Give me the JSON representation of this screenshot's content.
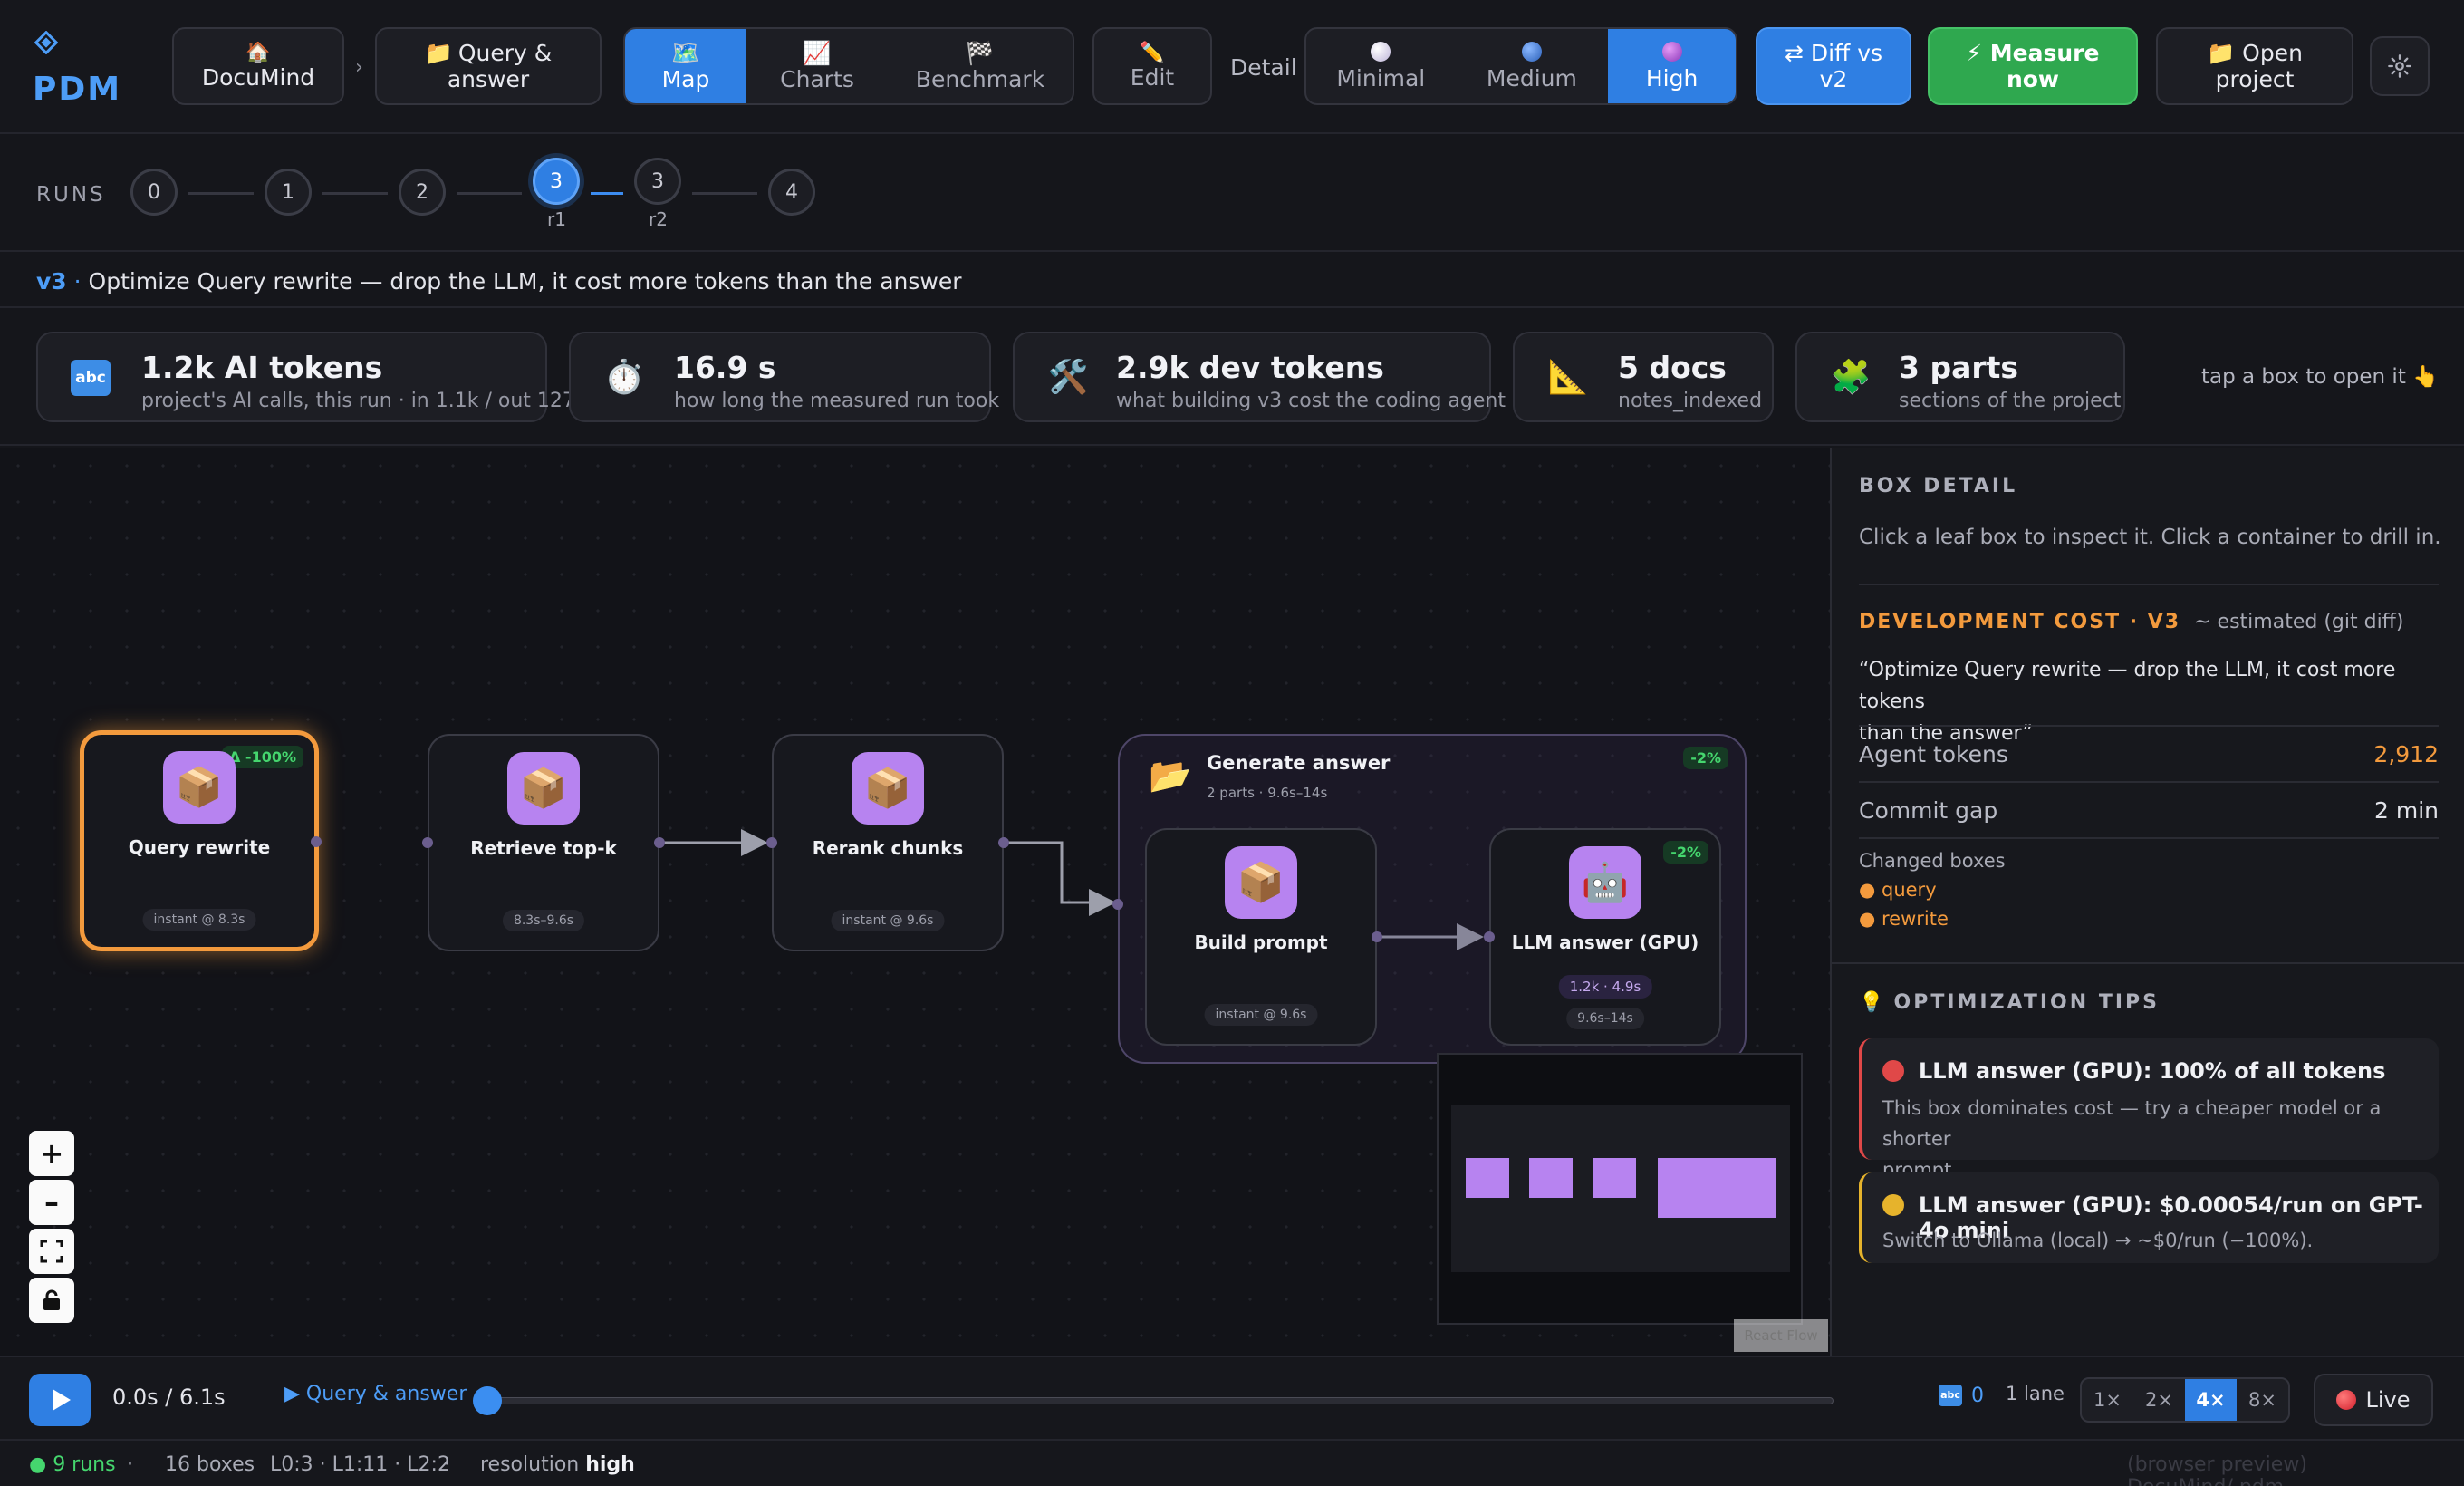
{
  "app": {
    "logo_icon": "diamond-icon",
    "name": "PDM",
    "accent": "#2f7fe3"
  },
  "breadcrumb": {
    "project": {
      "icon": "🏠",
      "label": "DocuMind"
    },
    "separator": "›",
    "flow": {
      "icon": "📁",
      "label_line1": "Query &",
      "label_line2": "answer"
    }
  },
  "views": [
    {
      "icon": "🗺️",
      "label": "Map",
      "active": true
    },
    {
      "icon": "📈",
      "label": "Charts",
      "active": false
    },
    {
      "icon": "🏁",
      "label": "Benchmark",
      "active": false
    }
  ],
  "edit": {
    "icon": "✏️",
    "label": "Edit"
  },
  "detail": {
    "label": "Detail",
    "options": [
      {
        "label": "Minimal",
        "color": "#e4dff0",
        "active": false
      },
      {
        "label": "Medium",
        "color": "#3b7bd8",
        "active": false
      },
      {
        "label": "High",
        "color": "#b55ad8",
        "active": true
      }
    ]
  },
  "diff_button": {
    "line1": "⇄ Diff vs",
    "line2": "v2"
  },
  "measure_button": {
    "line1": "⚡ Measure",
    "line2": "now",
    "color": "#2fa84f"
  },
  "open_button": {
    "line1": "📁 Open",
    "line2": "project"
  },
  "settings_icon": "gear-icon",
  "runs": {
    "label": "RUNS",
    "nodes": [
      {
        "num": "0",
        "sub": ""
      },
      {
        "num": "1",
        "sub": ""
      },
      {
        "num": "2",
        "sub": ""
      },
      {
        "num": "3",
        "sub": "r1",
        "active": true
      },
      {
        "num": "3",
        "sub": "r2"
      },
      {
        "num": "4",
        "sub": ""
      }
    ]
  },
  "commit": {
    "version": "v3",
    "separator": " · ",
    "message": "Optimize Query rewrite — drop the LLM, it cost more tokens than the answer"
  },
  "metrics": [
    {
      "icon": "abc-icon",
      "value": "1.2k AI tokens",
      "sub": "project's AI calls, this run · in 1.1k / out 127"
    },
    {
      "icon": "stopwatch-icon",
      "value": "16.9 s",
      "sub": "how long the measured run took"
    },
    {
      "icon": "tools-icon",
      "value": "2.9k dev tokens",
      "sub": "what building v3 cost the coding agent"
    },
    {
      "icon": "ruler-icon",
      "value": "5 docs",
      "sub": "notes_indexed"
    },
    {
      "icon": "puzzle-icon",
      "value": "3 parts",
      "sub": "sections of the project"
    }
  ],
  "tap_hint": "tap a box to open it 👆",
  "nodes": {
    "query_rewrite": {
      "label": "Query rewrite",
      "time": "instant @ 8.3s",
      "badge": "Δ -100%"
    },
    "retrieve": {
      "label": "Retrieve top-k",
      "time": "8.3s–9.6s"
    },
    "rerank": {
      "label": "Rerank chunks",
      "time": "instant @ 9.6s"
    },
    "generate": {
      "title": "Generate answer",
      "sub": "2 parts · 9.6s–14s",
      "badge": "-2%"
    },
    "build_prompt": {
      "label": "Build prompt",
      "time": "instant @ 9.6s"
    },
    "llm_answer": {
      "label": "LLM answer (GPU)",
      "tokens": "1.2k · 4.9s",
      "time": "9.6s–14s",
      "badge": "-2%"
    }
  },
  "reactflow_attribution": "React Flow",
  "panel": {
    "box_detail_heading": "BOX DETAIL",
    "box_detail_hint": "Click a leaf box to inspect it. Click a container to drill in.",
    "dev_cost_heading": "DEVELOPMENT COST · V3",
    "dev_cost_note": "~ estimated (git diff)",
    "quote_line1": "“Optimize Query rewrite — drop the LLM, it cost more tokens",
    "quote_line2": "than the answer”",
    "agent_tokens_label": "Agent tokens",
    "agent_tokens_value": "2,912",
    "commit_gap_label": "Commit gap",
    "commit_gap_value": "2 min",
    "changed_label": "Changed boxes",
    "changed": [
      "query",
      "rewrite"
    ],
    "tips_heading": "OPTIMIZATION TIPS",
    "tips": [
      {
        "title": "LLM answer (GPU): 100% of all tokens",
        "body_line1": "This box dominates cost — try a cheaper model or a shorter",
        "body_line2": "prompt.",
        "color": "#e04848"
      },
      {
        "title": "LLM answer (GPU): $0.00054/run on GPT-4o mini",
        "body_line1": "Switch to Ollama (local) → ~$0/run (−100%).",
        "color": "#e6b32c"
      }
    ]
  },
  "timeline": {
    "time": "0.0s / 6.1s",
    "scope": "▶ Query & answer",
    "progress": 0,
    "token_count": "0",
    "lanes": "1 lane",
    "speeds": [
      {
        "label": "1×",
        "active": false
      },
      {
        "label": "2×",
        "active": false
      },
      {
        "label": "4×",
        "active": true
      },
      {
        "label": "8×",
        "active": false
      }
    ],
    "live": "Live"
  },
  "status": {
    "runs": "● 9 runs",
    "sep": "·",
    "boxes": "16 boxes",
    "levels": "L0:3 · L1:11 · L2:2",
    "resolution_label": "resolution",
    "resolution_value": "high",
    "preview": "(browser preview) DocuMind/.pdm"
  }
}
